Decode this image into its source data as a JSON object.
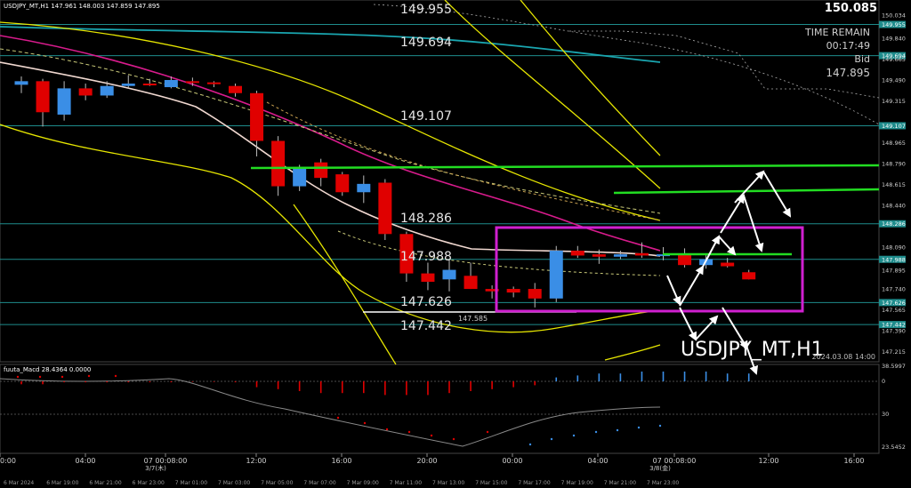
{
  "header": {
    "symbol_info": "USDJPY_MT,H1  147.961 148.003 147.859 147.895",
    "top_price": "150.085"
  },
  "info_panel": {
    "time_remain_label": "TIME REMAIN",
    "time_remain_value": "00:17:49",
    "bid_label": "Bid",
    "bid_value": "147.895"
  },
  "watermark": {
    "symbol": "USDJPY_MT,H1",
    "date": "2024.03.08 14:00"
  },
  "level_labels": [
    "149.955",
    "149.694",
    "149.107",
    "148.286",
    "147.988",
    "147.626",
    "147.442"
  ],
  "low_marker": "147.585",
  "colors": {
    "bull": "#3a8ee6",
    "bear": "#e00000",
    "level_line": "#1e8c8c",
    "ma_pink": "#d81b8c",
    "ma_white": "#f0d8d0",
    "band_yellow": "#e6e600",
    "support_green": "#22dd22",
    "box_magenta": "#d020d0",
    "macd_signal": "#8a8a8a",
    "cyan_line": "#1aa6b0"
  },
  "chart_data": [
    {
      "type": "candlestick",
      "title": "USDJPY_MT,H1",
      "ylim": [
        147.13,
        150.16
      ],
      "y_ticks": [
        "150.034",
        "149.955",
        "149.840",
        "149.694",
        "149.665",
        "149.490",
        "149.315",
        "149.107",
        "148.965",
        "148.790",
        "148.615",
        "148.440",
        "148.286",
        "148.090",
        "147.988",
        "147.895",
        "147.740",
        "147.626",
        "147.565",
        "147.442",
        "147.390",
        "147.215"
      ],
      "y_tick_values": [
        150.034,
        149.955,
        149.84,
        149.694,
        149.665,
        149.49,
        149.315,
        149.107,
        148.965,
        148.79,
        148.615,
        148.44,
        148.286,
        148.09,
        147.988,
        147.895,
        147.74,
        147.626,
        147.565,
        147.442,
        147.39,
        147.215
      ],
      "x_axis_top_labels": [
        "0:00",
        "04:00",
        "07 00:08:00",
        "12:00",
        "16:00",
        "20:00",
        "00:00",
        "04:00",
        "07 00:08:00",
        "12:00",
        "16:00"
      ],
      "x_axis_sub_labels": [
        "3/7(木)",
        "3/8(金)"
      ],
      "x_axis_bottom_labels": [
        "6 Mar 2024",
        "6 Mar 19:00",
        "6 Mar 21:00",
        "6 Mar 23:00",
        "7 Mar 01:00",
        "7 Mar 03:00",
        "7 Mar 05:00",
        "7 Mar 07:00",
        "7 Mar 09:00",
        "7 Mar 11:00",
        "7 Mar 13:00",
        "7 Mar 15:00",
        "7 Mar 17:00",
        "7 Mar 19:00",
        "7 Mar 21:00",
        "7 Mar 23:00"
      ],
      "candles": [
        {
          "o": 149.45,
          "h": 149.52,
          "l": 149.38,
          "c": 149.48
        },
        {
          "o": 149.48,
          "h": 149.5,
          "l": 149.1,
          "c": 149.22
        },
        {
          "o": 149.2,
          "h": 149.48,
          "l": 149.15,
          "c": 149.42
        },
        {
          "o": 149.42,
          "h": 149.46,
          "l": 149.32,
          "c": 149.36
        },
        {
          "o": 149.36,
          "h": 149.48,
          "l": 149.34,
          "c": 149.44
        },
        {
          "o": 149.44,
          "h": 149.53,
          "l": 149.42,
          "c": 149.46
        },
        {
          "o": 149.46,
          "h": 149.5,
          "l": 149.44,
          "c": 149.45
        },
        {
          "o": 149.43,
          "h": 149.52,
          "l": 149.42,
          "c": 149.49
        },
        {
          "o": 149.48,
          "h": 149.51,
          "l": 149.44,
          "c": 149.47
        },
        {
          "o": 149.47,
          "h": 149.48,
          "l": 149.43,
          "c": 149.46
        },
        {
          "o": 149.44,
          "h": 149.46,
          "l": 149.35,
          "c": 149.38
        },
        {
          "o": 149.38,
          "h": 149.4,
          "l": 148.85,
          "c": 148.98
        },
        {
          "o": 148.98,
          "h": 149.02,
          "l": 148.52,
          "c": 148.6
        },
        {
          "o": 148.6,
          "h": 148.78,
          "l": 148.56,
          "c": 148.76
        },
        {
          "o": 148.8,
          "h": 148.83,
          "l": 148.6,
          "c": 148.67
        },
        {
          "o": 148.7,
          "h": 148.72,
          "l": 148.52,
          "c": 148.55
        },
        {
          "o": 148.55,
          "h": 148.69,
          "l": 148.46,
          "c": 148.62
        },
        {
          "o": 148.63,
          "h": 148.66,
          "l": 148.15,
          "c": 148.2
        },
        {
          "o": 148.2,
          "h": 148.22,
          "l": 147.8,
          "c": 147.87
        },
        {
          "o": 147.87,
          "h": 147.96,
          "l": 147.73,
          "c": 147.8
        },
        {
          "o": 147.82,
          "h": 147.99,
          "l": 147.72,
          "c": 147.9
        },
        {
          "o": 147.85,
          "h": 147.96,
          "l": 147.74,
          "c": 147.74
        },
        {
          "o": 147.74,
          "h": 147.77,
          "l": 147.66,
          "c": 147.72
        },
        {
          "o": 147.74,
          "h": 147.76,
          "l": 147.67,
          "c": 147.71
        },
        {
          "o": 147.74,
          "h": 147.79,
          "l": 147.585,
          "c": 147.66
        },
        {
          "o": 147.66,
          "h": 148.1,
          "l": 147.63,
          "c": 148.06
        },
        {
          "o": 148.06,
          "h": 148.1,
          "l": 148.0,
          "c": 148.02
        },
        {
          "o": 148.03,
          "h": 148.07,
          "l": 147.95,
          "c": 148.01
        },
        {
          "o": 148.01,
          "h": 148.06,
          "l": 147.99,
          "c": 148.03
        },
        {
          "o": 148.04,
          "h": 148.13,
          "l": 148.0,
          "c": 148.02
        },
        {
          "o": 148.03,
          "h": 148.09,
          "l": 147.98,
          "c": 148.03
        },
        {
          "o": 148.03,
          "h": 148.08,
          "l": 147.92,
          "c": 147.94
        },
        {
          "o": 147.94,
          "h": 148.03,
          "l": 147.91,
          "c": 147.99
        },
        {
          "o": 147.96,
          "h": 148.0,
          "l": 147.92,
          "c": 147.93
        },
        {
          "o": 147.88,
          "h": 147.9,
          "l": 147.82,
          "c": 147.82
        }
      ],
      "indicator": {
        "name": "fuuta_Macd 28.4364 0.0000",
        "scale_labels": [
          "38.5997",
          "0",
          "30",
          "23.5452"
        ],
        "histogram": [
          -1.5,
          -1.5,
          -0.5,
          -0.5,
          -0.5,
          -0.5,
          -0.5,
          -0.5,
          -0.3,
          -0.3,
          -0.5,
          -3,
          -4,
          -5,
          -6,
          -6,
          -6,
          -7,
          -7,
          -7,
          -6,
          -5,
          -4,
          -3,
          -2,
          2,
          3,
          4,
          4,
          5,
          5,
          5,
          5,
          4,
          4
        ]
      }
    }
  ]
}
